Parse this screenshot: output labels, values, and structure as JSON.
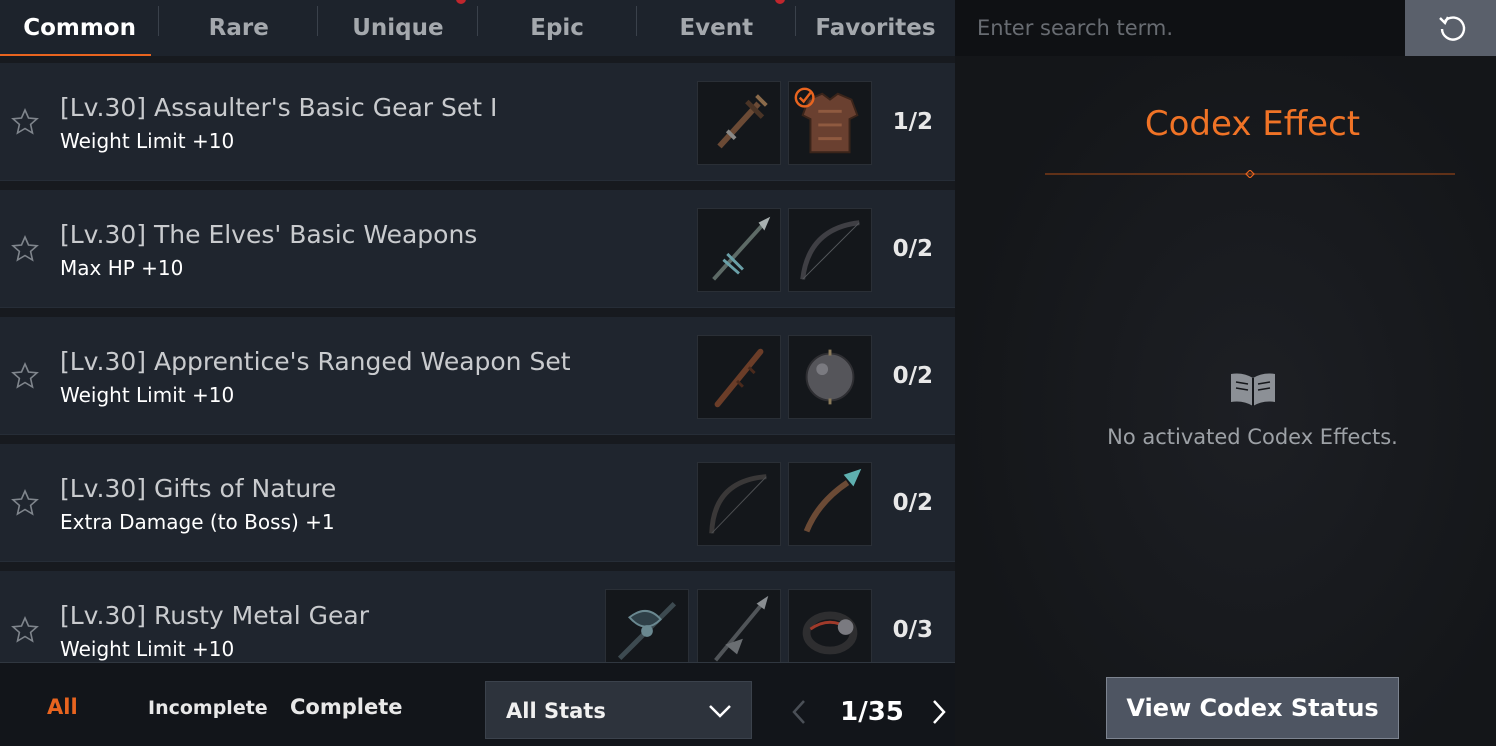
{
  "tabs": [
    {
      "label": "Common",
      "active": true,
      "badge": false
    },
    {
      "label": "Rare",
      "active": false,
      "badge": false
    },
    {
      "label": "Unique",
      "active": false,
      "badge": true
    },
    {
      "label": "Epic",
      "active": false,
      "badge": false
    },
    {
      "label": "Event",
      "active": false,
      "badge": true
    },
    {
      "label": "Favorites",
      "active": false,
      "badge": false
    }
  ],
  "sets": [
    {
      "title": "[Lv.30] Assaulter's Basic Gear Set I",
      "effect": "Weight Limit +10",
      "count": "1/2",
      "items": [
        {
          "icon": "crossbow-icon",
          "collected": false
        },
        {
          "icon": "armor-icon",
          "collected": true
        }
      ]
    },
    {
      "title": "[Lv.30] The Elves' Basic Weapons",
      "effect": "Max HP +10",
      "count": "0/2",
      "items": [
        {
          "icon": "spear-icon",
          "collected": false
        },
        {
          "icon": "bow-icon",
          "collected": false
        }
      ]
    },
    {
      "title": "[Lv.30] Apprentice's Ranged Weapon Set",
      "effect": "Weight Limit +10",
      "count": "0/2",
      "items": [
        {
          "icon": "staff-icon",
          "collected": false
        },
        {
          "icon": "orb-icon",
          "collected": false
        }
      ]
    },
    {
      "title": "[Lv.30] Gifts of Nature",
      "effect": "Extra Damage (to Boss) +1",
      "count": "0/2",
      "items": [
        {
          "icon": "bow-icon",
          "collected": false
        },
        {
          "icon": "wand-icon",
          "collected": false
        }
      ]
    },
    {
      "title": "[Lv.30] Rusty Metal Gear",
      "effect": "Weight Limit +10",
      "count": "0/3",
      "items": [
        {
          "icon": "axe-icon",
          "collected": false
        },
        {
          "icon": "spear-icon",
          "collected": false
        },
        {
          "icon": "ring-icon",
          "collected": false
        }
      ]
    }
  ],
  "filters": {
    "all": "All",
    "incomplete": "Incomplete",
    "complete": "Complete"
  },
  "stats_dropdown": {
    "value": "All Stats"
  },
  "pager": {
    "text": "1/35"
  },
  "search": {
    "placeholder": "Enter search term."
  },
  "codex": {
    "title": "Codex Effect",
    "empty_text": "No activated Codex Effects.",
    "view_button": "View Codex Status"
  },
  "colors": {
    "accent": "#e8641f",
    "badge": "#c0262d"
  }
}
